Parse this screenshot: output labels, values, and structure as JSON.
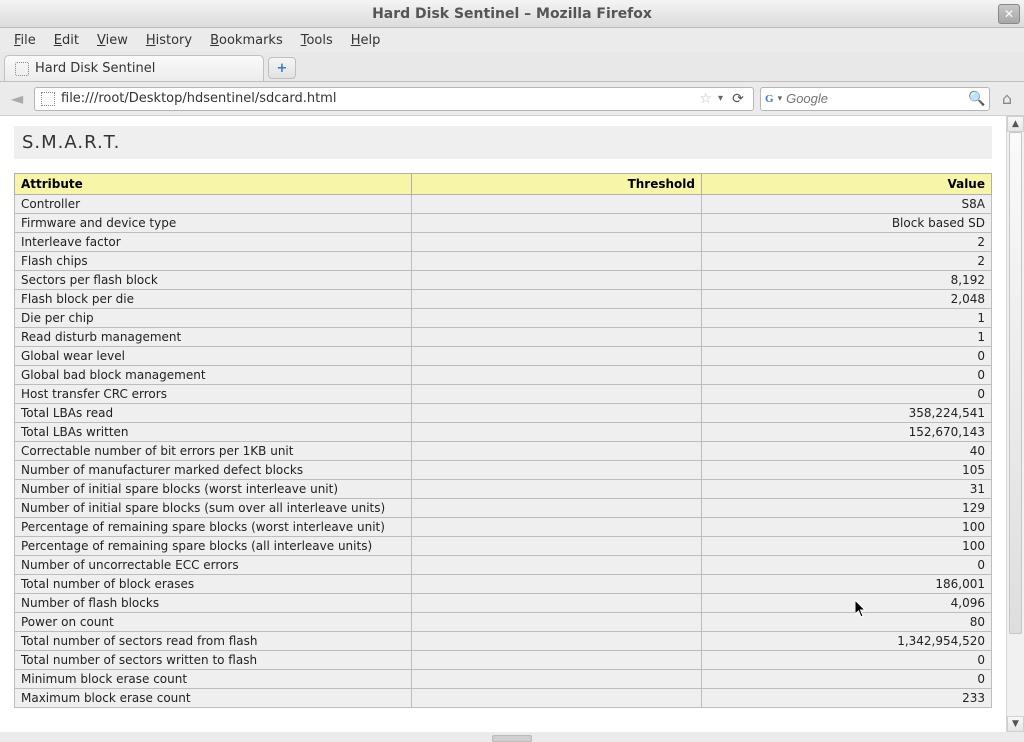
{
  "window": {
    "title": "Hard Disk Sentinel – Mozilla Firefox"
  },
  "menu": {
    "file": "File",
    "edit": "Edit",
    "view": "View",
    "history": "History",
    "bookmarks": "Bookmarks",
    "tools": "Tools",
    "help": "Help"
  },
  "tab": {
    "label": "Hard Disk Sentinel"
  },
  "url": "file:///root/Desktop/hdsentinel/sdcard.html",
  "search": {
    "placeholder": "Google"
  },
  "section": "S.M.A.R.T.",
  "headers": {
    "attribute": "Attribute",
    "threshold": "Threshold",
    "value": "Value"
  },
  "rows": [
    {
      "attr": "Controller",
      "thres": "",
      "val": "S8A"
    },
    {
      "attr": "Firmware and device type",
      "thres": "",
      "val": "Block based SD"
    },
    {
      "attr": "Interleave factor",
      "thres": "",
      "val": "2"
    },
    {
      "attr": "Flash chips",
      "thres": "",
      "val": "2"
    },
    {
      "attr": "Sectors per flash block",
      "thres": "",
      "val": "8,192"
    },
    {
      "attr": "Flash block per die",
      "thres": "",
      "val": "2,048"
    },
    {
      "attr": "Die per chip",
      "thres": "",
      "val": "1"
    },
    {
      "attr": "Read disturb management",
      "thres": "",
      "val": "1"
    },
    {
      "attr": "Global wear level",
      "thres": "",
      "val": "0"
    },
    {
      "attr": "Global bad block management",
      "thres": "",
      "val": "0"
    },
    {
      "attr": "Host transfer CRC errors",
      "thres": "",
      "val": "0"
    },
    {
      "attr": "Total LBAs read",
      "thres": "",
      "val": "358,224,541"
    },
    {
      "attr": "Total LBAs written",
      "thres": "",
      "val": "152,670,143"
    },
    {
      "attr": "Correctable number of bit errors per 1KB unit",
      "thres": "",
      "val": "40"
    },
    {
      "attr": "Number of manufacturer marked defect blocks",
      "thres": "",
      "val": "105"
    },
    {
      "attr": "Number of initial spare blocks (worst interleave unit)",
      "thres": "",
      "val": "31"
    },
    {
      "attr": "Number of initial spare blocks (sum over all interleave units)",
      "thres": "",
      "val": "129"
    },
    {
      "attr": "Percentage of remaining spare blocks (worst interleave unit)",
      "thres": "",
      "val": "100"
    },
    {
      "attr": "Percentage of remaining spare blocks (all interleave units)",
      "thres": "",
      "val": "100"
    },
    {
      "attr": "Number of uncorrectable ECC errors",
      "thres": "",
      "val": "0"
    },
    {
      "attr": "Total number of block erases",
      "thres": "",
      "val": "186,001"
    },
    {
      "attr": "Number of flash blocks",
      "thres": "",
      "val": "4,096"
    },
    {
      "attr": "Power on count",
      "thres": "",
      "val": "80"
    },
    {
      "attr": "Total number of sectors read from flash",
      "thres": "",
      "val": "1,342,954,520"
    },
    {
      "attr": "Total number of sectors written to flash",
      "thres": "",
      "val": "0"
    },
    {
      "attr": "Minimum block erase count",
      "thres": "",
      "val": "0"
    },
    {
      "attr": "Maximum block erase count",
      "thres": "",
      "val": "233"
    }
  ]
}
